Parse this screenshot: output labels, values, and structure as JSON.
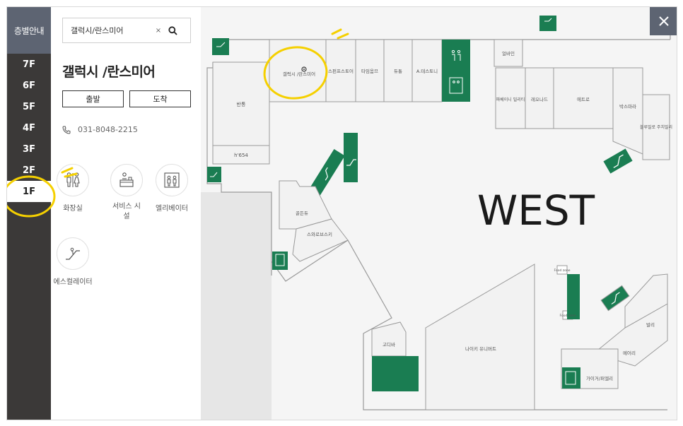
{
  "rail": {
    "header": "층별안내",
    "floors": [
      "7F",
      "6F",
      "5F",
      "4F",
      "3F",
      "2F",
      "1F"
    ],
    "active": "1F"
  },
  "panel": {
    "search_value": "갤럭시/란스미어",
    "clear_label": "×",
    "store_title": "갤럭시 /란스미어",
    "depart_label": "출발",
    "arrive_label": "도착",
    "phone": "031-8048-2215",
    "amenities": [
      {
        "icon": "restroom-icon",
        "label": "화장실"
      },
      {
        "icon": "service-desk-icon",
        "label": "서비스 시설"
      },
      {
        "icon": "elevator-icon",
        "label": "엘리베이터"
      },
      {
        "icon": "escalator-icon",
        "label": "에스컬레이터"
      }
    ]
  },
  "map": {
    "zone_label": "WEST",
    "stores": {
      "galaxy": "갤럭시 /란스미어",
      "shop2": "스펀프스토어",
      "shop3": "타임옴므",
      "shop4": "듀통",
      "shop5": "A.테스토니",
      "bandong": "반통",
      "h654": "h'654",
      "goldenju": "골든듀",
      "swarovski": "스와로브스키",
      "ujunin": "얼바인",
      "ferragamo": "파베이니 밀리티",
      "leonard": "레오나드",
      "etro": "에트로",
      "maxmara": "박스마라",
      "blumarine": "블루밀로 주치밀리",
      "godiva": "고디바",
      "nike": "나이키 유니버트",
      "bally": "발리",
      "tiffany": "메어리",
      "gaigapa": "가이거/퍼엘리",
      "food1": "Food zone",
      "food2": "Food zone"
    }
  },
  "colors": {
    "rail_bg": "#3b3938",
    "header_bg": "#5d6472",
    "facility_green": "#1a7d52",
    "highlight_yellow": "#f5d000"
  }
}
